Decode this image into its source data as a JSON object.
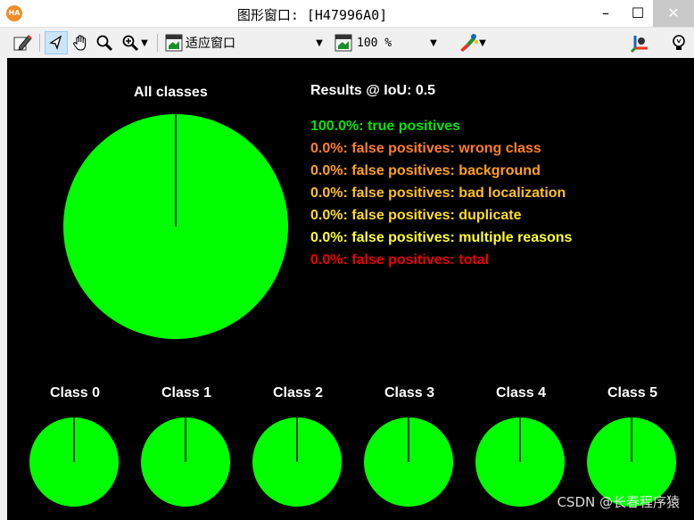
{
  "window": {
    "title": "图形窗口: [H47996A0]",
    "app_icon_text": "HA",
    "minimize_glyph": "–",
    "maximize_glyph": "☐",
    "close_glyph": "✕"
  },
  "toolbar": {
    "fit_window_label": "适应窗口",
    "zoom_value": "100 %",
    "icons": [
      "edit-icon",
      "pointer-icon",
      "hand-icon",
      "magnifier-icon",
      "zoom-in-icon",
      "fit-window-icon",
      "zoom-window-icon",
      "color-paint-icon",
      "axes-icon",
      "lightbulb-icon"
    ]
  },
  "chart_data": [
    {
      "type": "pie",
      "title": "All classes",
      "slices": [
        {
          "label": "true positives",
          "value": 100.0,
          "color": "#00ff00"
        }
      ]
    },
    {
      "type": "pie",
      "title": "Class 0",
      "slices": [
        {
          "label": "true positives",
          "value": 100.0,
          "color": "#00ff00"
        }
      ]
    },
    {
      "type": "pie",
      "title": "Class 1",
      "slices": [
        {
          "label": "true positives",
          "value": 100.0,
          "color": "#00ff00"
        }
      ]
    },
    {
      "type": "pie",
      "title": "Class 2",
      "slices": [
        {
          "label": "true positives",
          "value": 100.0,
          "color": "#00ff00"
        }
      ]
    },
    {
      "type": "pie",
      "title": "Class 3",
      "slices": [
        {
          "label": "true positives",
          "value": 100.0,
          "color": "#00ff00"
        }
      ]
    },
    {
      "type": "pie",
      "title": "Class 4",
      "slices": [
        {
          "label": "true positives",
          "value": 100.0,
          "color": "#00ff00"
        }
      ]
    },
    {
      "type": "pie",
      "title": "Class 5",
      "slices": [
        {
          "label": "true positives",
          "value": 100.0,
          "color": "#00ff00"
        }
      ]
    }
  ],
  "results": {
    "title": "Results @ IoU: 0.5",
    "items": [
      {
        "text": "100.0%: true positives",
        "color": "#00e600"
      },
      {
        "text": "0.0%: false positives: wrong class",
        "color": "#ff7f27"
      },
      {
        "text": "0.0%: false positives: background",
        "color": "#ffa020"
      },
      {
        "text": "0.0%: false positives: bad localization",
        "color": "#ffc020"
      },
      {
        "text": "0.0%: false positives: duplicate",
        "color": "#ffdd20"
      },
      {
        "text": "0.0%: false positives: multiple reasons",
        "color": "#ffff30"
      },
      {
        "text": "0.0%: false positives: total",
        "color": "#ee0000"
      }
    ]
  },
  "colors": {
    "canvas_background": "#000000",
    "pie_fill": "#00ff00",
    "pie_divider": "#000000"
  },
  "watermark": "CSDN @长春程序猿"
}
